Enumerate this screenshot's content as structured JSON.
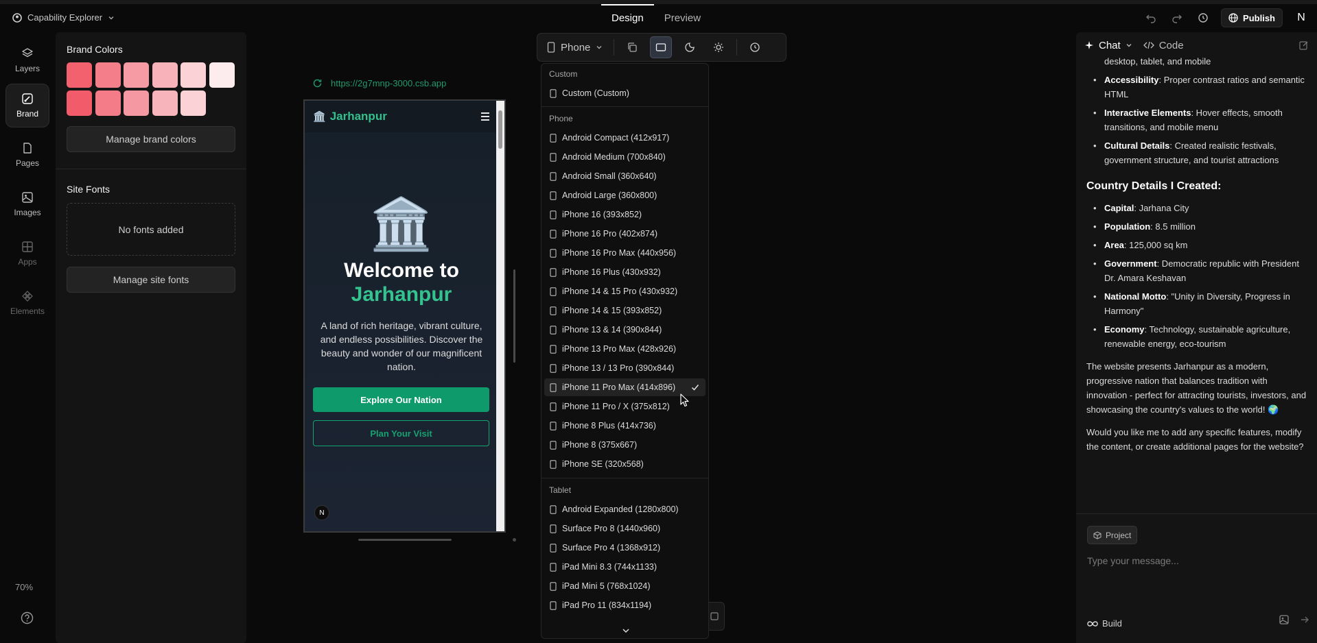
{
  "app": {
    "title": "Capability Explorer",
    "mode_tabs": [
      "Design",
      "Preview"
    ],
    "active_mode": "Design",
    "publish_label": "Publish",
    "avatar_initial": "N"
  },
  "rail": {
    "items": [
      {
        "label": "Layers",
        "icon": "layers-icon"
      },
      {
        "label": "Brand",
        "icon": "brush-icon"
      },
      {
        "label": "Pages",
        "icon": "page-icon"
      },
      {
        "label": "Images",
        "icon": "image-icon"
      },
      {
        "label": "Apps",
        "icon": "grid-icon"
      },
      {
        "label": "Elements",
        "icon": "elements-icon"
      }
    ],
    "zoom": "70%"
  },
  "brand_panel": {
    "colors_title": "Brand Colors",
    "swatches_row1": [
      "#f3606e",
      "#f47f8a",
      "#f69aa3",
      "#f8b3ba",
      "#fbd2d6",
      "#fdeced"
    ],
    "swatches_row2": [
      "#f25b6a",
      "#f47c88",
      "#f698a1",
      "#f8b4bb",
      "#fbd3d7"
    ],
    "manage_colors_label": "Manage brand colors",
    "fonts_title": "Site Fonts",
    "no_fonts_label": "No fonts added",
    "manage_fonts_label": "Manage site fonts"
  },
  "canvas": {
    "url": "https://2g7mnp-3000.csb.app"
  },
  "site": {
    "logo_emoji": "🏛️",
    "logo_text": "Jarhanpur",
    "hero_emoji": "🏛️",
    "hero_title_line1": "Welcome to",
    "hero_title_line2": "Jarhanpur",
    "hero_desc": "A land of rich heritage, vibrant culture, and endless possibilities. Discover the beauty and wonder of our magnificent nation.",
    "primary_button": "Explore Our Nation",
    "secondary_button": "Plan Your Visit",
    "badge": "N"
  },
  "device_toolbar": {
    "device_label": "Phone"
  },
  "device_dropdown": {
    "groups": [
      {
        "label": "Custom",
        "items": [
          "Custom (Custom)"
        ]
      },
      {
        "label": "Phone",
        "items": [
          "Android Compact (412x917)",
          "Android Medium (700x840)",
          "Android Small (360x640)",
          "Android Large (360x800)",
          "iPhone 16 (393x852)",
          "iPhone 16 Pro (402x874)",
          "iPhone 16 Pro Max (440x956)",
          "iPhone 16 Plus (430x932)",
          "iPhone 14 & 15 Pro (430x932)",
          "iPhone 14 & 15 (393x852)",
          "iPhone 13 & 14 (390x844)",
          "iPhone 13 Pro Max (428x926)",
          "iPhone 13 / 13 Pro (390x844)",
          "iPhone 11 Pro Max (414x896)",
          "iPhone 11 Pro / X (375x812)",
          "iPhone 8 Plus (414x736)",
          "iPhone 8 (375x667)",
          "iPhone SE (320x568)"
        ]
      },
      {
        "label": "Tablet",
        "items": [
          "Android Expanded (1280x800)",
          "Surface Pro 8 (1440x960)",
          "Surface Pro 4 (1368x912)",
          "iPad Mini 8.3 (744x1133)",
          "iPad Mini 5 (768x1024)",
          "iPad Pro 11 (834x1194)"
        ]
      }
    ],
    "selected": "iPhone 11 Pro Max (414x896)"
  },
  "chat": {
    "tabs": [
      "Chat",
      "Code"
    ],
    "intro_fragment": "desktop, tablet, and mobile",
    "features": [
      {
        "term": "Accessibility",
        "text": ": Proper contrast ratios and semantic HTML"
      },
      {
        "term": "Interactive Elements",
        "text": ": Hover effects, smooth transitions, and mobile menu"
      },
      {
        "term": "Cultural Details",
        "text": ": Created realistic festivals, government structure, and tourist attractions"
      }
    ],
    "details_heading": "Country Details I Created:",
    "details": [
      {
        "term": "Capital",
        "text": ": Jarhana City"
      },
      {
        "term": "Population",
        "text": ": 8.5 million"
      },
      {
        "term": "Area",
        "text": ": 125,000 sq km"
      },
      {
        "term": "Government",
        "text": ": Democratic republic with President Dr. Amara Keshavan"
      },
      {
        "term": "National Motto",
        "text": ": \"Unity in Diversity, Progress in Harmony\""
      },
      {
        "term": "Economy",
        "text": ": Technology, sustainable agriculture, renewable energy, eco-tourism"
      }
    ],
    "paragraph1": "The website presents Jarhanpur as a modern, progressive nation that balances tradition with innovation - perfect for attracting tourists, investors, and showcasing the country's values to the world! 🌍",
    "paragraph2": "Would you like me to add any specific features, modify the content, or create additional pages for the website?",
    "project_chip": "Project",
    "input_placeholder": "Type your message...",
    "build_label": "Build"
  }
}
